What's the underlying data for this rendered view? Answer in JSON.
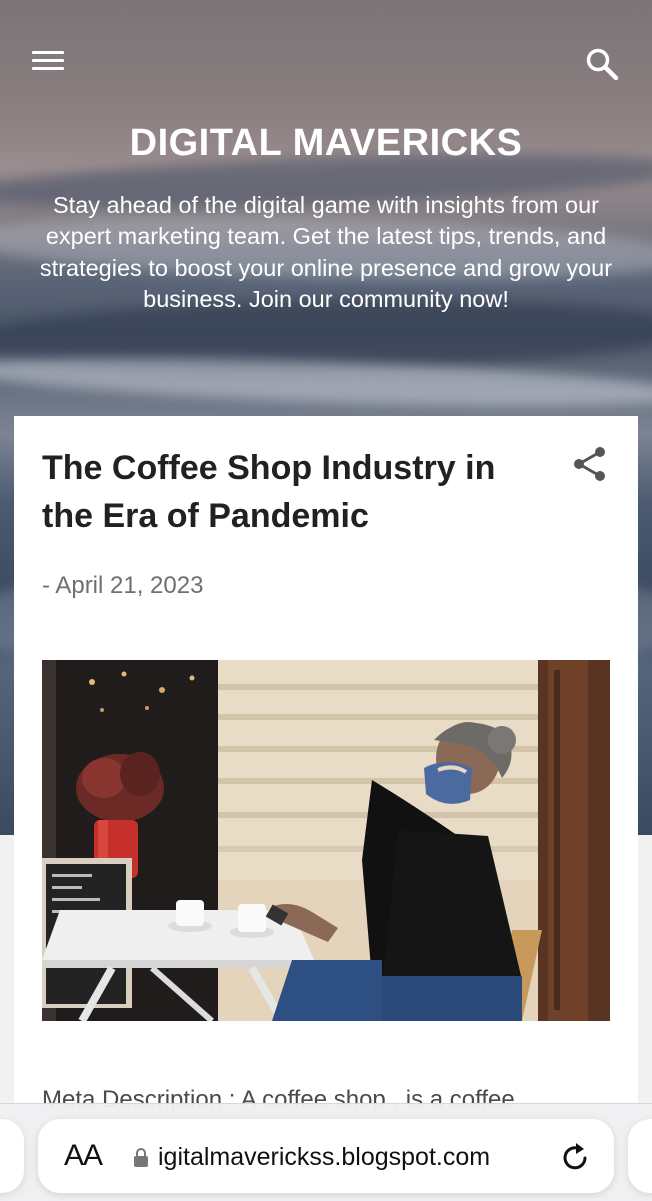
{
  "header": {
    "menu_icon": "hamburger-menu-icon",
    "search_icon": "search-icon",
    "blog_title": "DIGITAL MAVERICKS",
    "description": "Stay ahead of the digital game with insights from our expert marketing team. Get the latest tips, trends, and strategies to boost your online presence and grow your business. Join our community now!"
  },
  "post": {
    "title": "The Coffee Shop Industry in the Era of Pandemic",
    "date": "- April 21, 2023",
    "share_icon": "share-icon",
    "image_icon": "post-photo",
    "meta_description": "Meta Description : A coffee shop , is a coffee"
  },
  "browser": {
    "text_size_label": "AA",
    "lock_icon": "lock-icon",
    "url": "igitalmaverickss.blogspot.com",
    "reload_icon": "reload-icon"
  },
  "colors": {
    "card_background": "#ffffff",
    "title_text": "#212121",
    "date_text": "#6f6f6f"
  }
}
